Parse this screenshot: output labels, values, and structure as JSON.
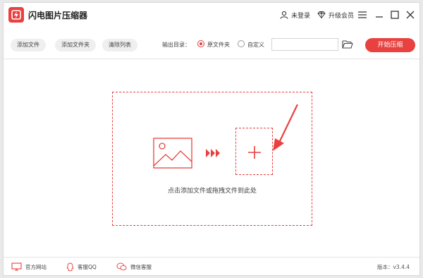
{
  "window": {
    "title": "闪电图片压缩器"
  },
  "titlebar": {
    "login_label": "未登录",
    "vip_label": "升级会员"
  },
  "toolbar": {
    "add_file": "添加文件",
    "add_folder": "添加文件夹",
    "clear_list": "清除列表",
    "output_label": "输出目录：",
    "option_original": "原文件夹",
    "option_custom": "自定义",
    "path_value": "",
    "start_label": "开始压缩",
    "selected_option": "原文件夹"
  },
  "dropzone": {
    "hint": "点击添加文件或拖拽文件到此处"
  },
  "footer": {
    "website": "官方网站",
    "qq": "客服QQ",
    "wechat": "微信客服",
    "version": "版本：v3.4.4"
  },
  "colors": {
    "accent": "#e8413f",
    "text": "#333333"
  }
}
